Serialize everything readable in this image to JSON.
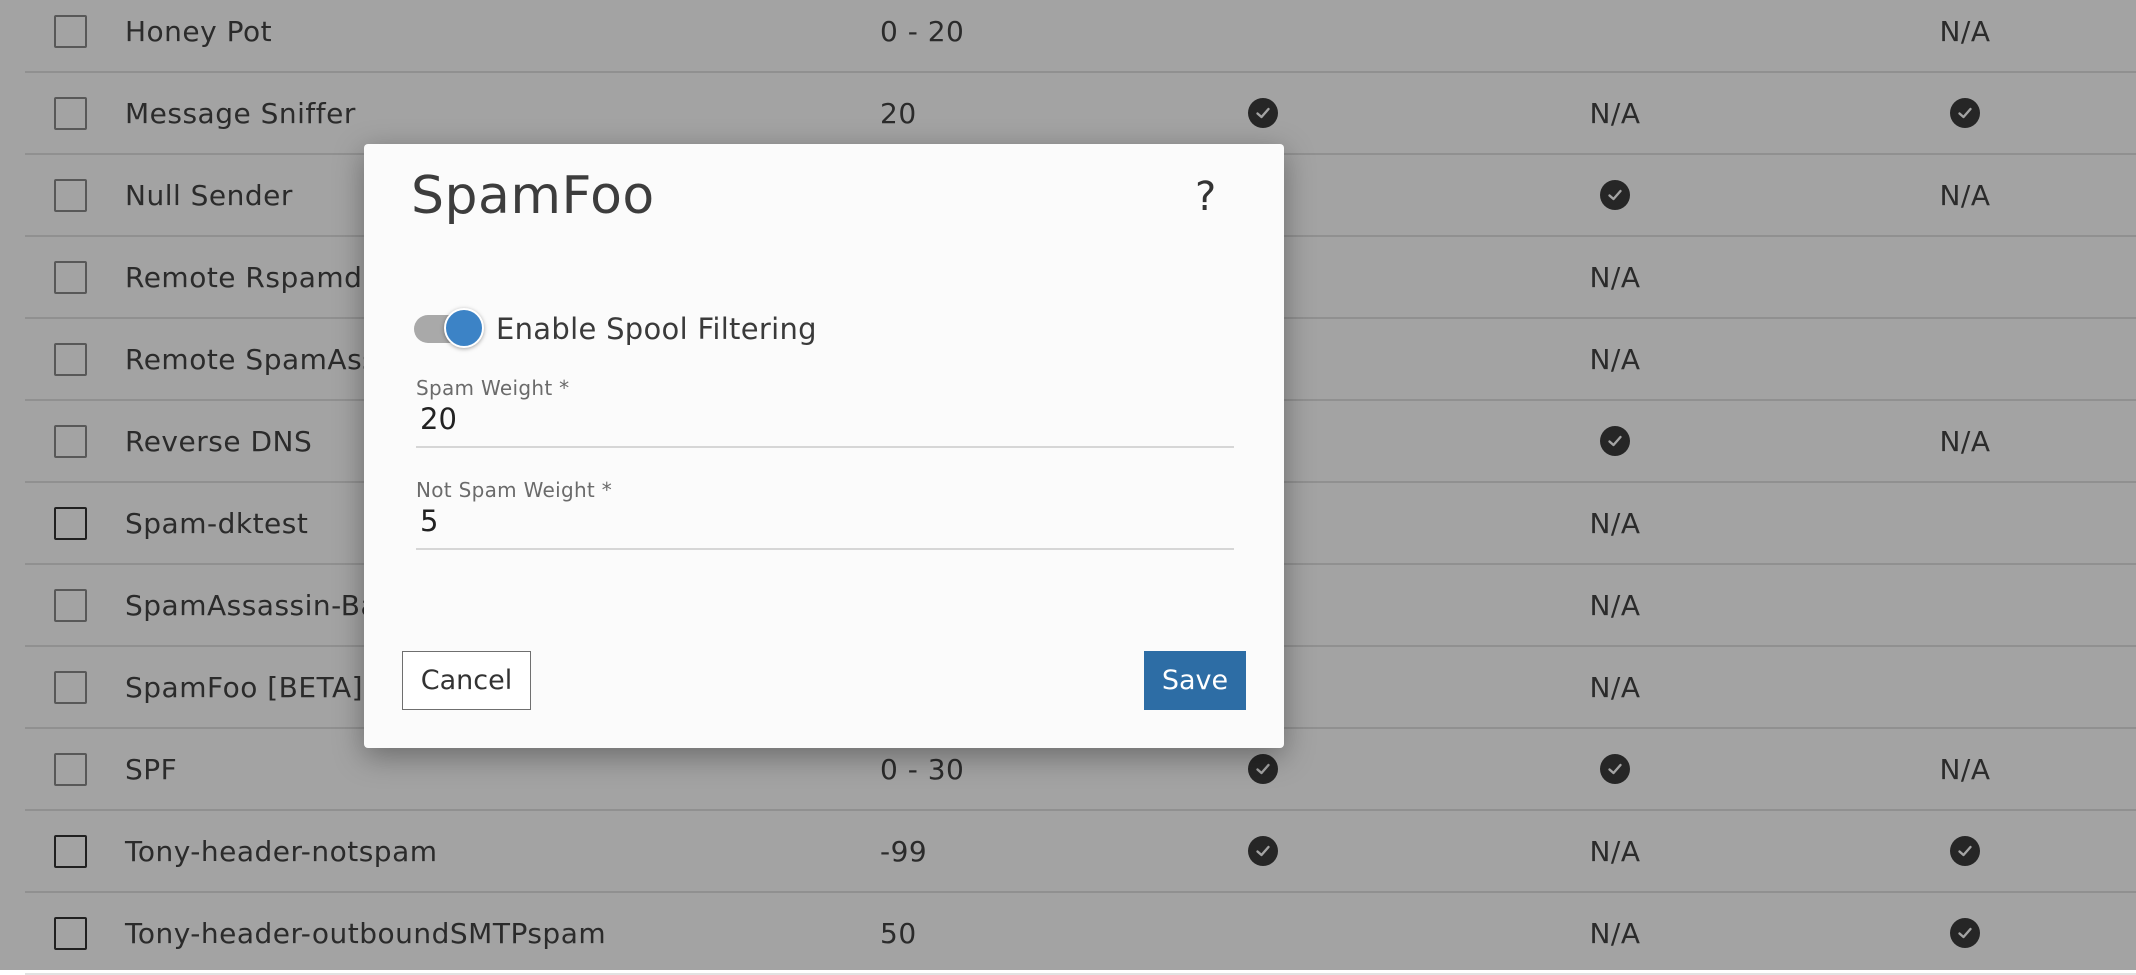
{
  "table": {
    "rows": [
      {
        "name": "Honey Pot",
        "weight": "0 - 20",
        "c1": false,
        "c2": "",
        "c3": "N/A"
      },
      {
        "name": "Message Sniffer",
        "weight": "20",
        "c1": true,
        "c2": "N/A",
        "c3": true
      },
      {
        "name": "Null Sender",
        "weight": "",
        "c1": false,
        "c2": true,
        "c3": "N/A"
      },
      {
        "name": "Remote Rspamd",
        "weight": "",
        "c1": false,
        "c2": "N/A",
        "c3": ""
      },
      {
        "name": "Remote SpamAssa",
        "weight": "",
        "c1": false,
        "c2": "N/A",
        "c3": ""
      },
      {
        "name": "Reverse DNS",
        "weight": "",
        "c1": false,
        "c2": true,
        "c3": "N/A"
      },
      {
        "name": "Spam-dktest",
        "weight": "",
        "c1": false,
        "c2": "N/A",
        "c3": "",
        "dark_checkbox": true
      },
      {
        "name": "SpamAssassin-Ba",
        "weight": "",
        "c1": false,
        "c2": "N/A",
        "c3": ""
      },
      {
        "name": "SpamFoo [BETA]",
        "weight": "",
        "c1": false,
        "c2": "N/A",
        "c3": ""
      },
      {
        "name": "SPF",
        "weight": "0 - 30",
        "c1": true,
        "c2": true,
        "c3": "N/A"
      },
      {
        "name": "Tony-header-notspam",
        "weight": "-99",
        "c1": true,
        "c2": "N/A",
        "c3": true,
        "dark_checkbox": true
      },
      {
        "name": "Tony-header-outboundSMTPspam",
        "weight": "50",
        "c1": false,
        "c2": "N/A",
        "c3": true,
        "dark_checkbox": true
      }
    ]
  },
  "dialog": {
    "title": "SpamFoo",
    "help_label": "?",
    "toggle_label": "Enable Spool Filtering",
    "toggle_on": true,
    "spam_weight": {
      "label": "Spam Weight *",
      "value": "20"
    },
    "not_spam_weight": {
      "label": "Not Spam Weight *",
      "value": "5"
    },
    "cancel_label": "Cancel",
    "save_label": "Save"
  },
  "colors": {
    "accent": "#3c83c6",
    "save_button": "#2d6da5",
    "check_icon": "#3c3c3c",
    "overlay": "rgba(0,0,0,0.36)"
  }
}
